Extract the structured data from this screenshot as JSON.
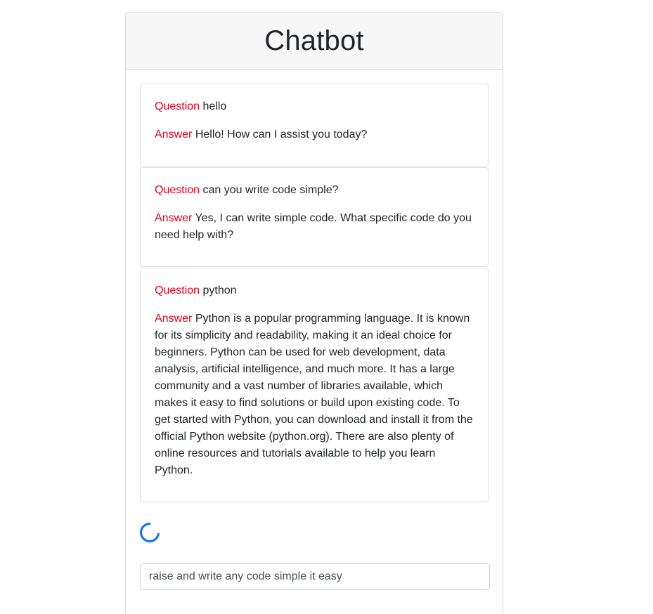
{
  "header": {
    "title": "Chatbot"
  },
  "labels": {
    "question": "Question",
    "answer": "Answer"
  },
  "conversation": [
    {
      "question": "hello",
      "answer": "Hello! How can I assist you today?"
    },
    {
      "question": "can you write code simple?",
      "answer": "Yes, I can write simple code. What specific code do you need help with?"
    },
    {
      "question": "python",
      "answer": "Python is a popular programming language. It is known for its simplicity and readability, making it an ideal choice for beginners. Python can be used for web development, data analysis, artificial intelligence, and much more. It has a large community and a vast number of libraries available, which makes it easy to find solutions or build upon existing code. To get started with Python, you can download and install it from the official Python website (python.org). There are also plenty of online resources and tutorials available to help you learn Python."
    }
  ],
  "status": {
    "loading": true,
    "spinner_icon": "loading-spinner-icon"
  },
  "input": {
    "value": "raise and write any code simple it easy"
  },
  "colors": {
    "label": "#e0001b",
    "spinner": "#0d6efd",
    "header_bg": "#f7f7f7"
  }
}
